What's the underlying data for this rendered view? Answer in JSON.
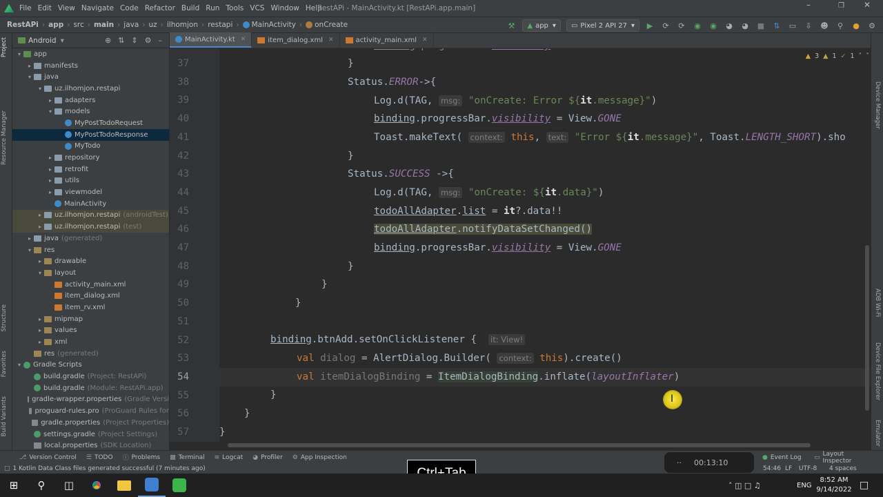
{
  "menubar": {
    "items": [
      "File",
      "Edit",
      "View",
      "Navigate",
      "Code",
      "Refactor",
      "Build",
      "Run",
      "Tools",
      "VCS",
      "Window",
      "Help"
    ],
    "title": "RestAPi - MainActivity.kt [RestAPi.app.main]"
  },
  "navbar": {
    "breadcrumbs": [
      "RestAPi",
      "app",
      "src",
      "main",
      "java",
      "uz",
      "ilhomjon",
      "restapi",
      "MainActivity",
      "onCreate"
    ],
    "run_config": "app",
    "device": "Pixel 2 API 27"
  },
  "left_strip": {
    "project": "Project",
    "resource_manager": "Resource Manager",
    "structure": "Structure",
    "favorites": "Favorites",
    "build_variants": "Build Variants"
  },
  "right_strip": {
    "device_manager": "Device Manager",
    "adb_wifi": "ADB Wi-Fi",
    "device_file_explorer": "Device File Explorer",
    "emulator": "Emulator"
  },
  "project": {
    "view": "Android",
    "tree": [
      {
        "label": "app",
        "icon": "app",
        "depth": 0,
        "arrow": "▾"
      },
      {
        "label": "manifests",
        "icon": "folder",
        "depth": 1,
        "arrow": "▸"
      },
      {
        "label": "java",
        "icon": "folder",
        "depth": 1,
        "arrow": "▾"
      },
      {
        "label": "uz.ilhomjon.restapi",
        "icon": "pkg",
        "depth": 2,
        "arrow": "▾"
      },
      {
        "label": "adapters",
        "icon": "pkg",
        "depth": 3,
        "arrow": "▸"
      },
      {
        "label": "models",
        "icon": "pkg",
        "depth": 3,
        "arrow": "▾"
      },
      {
        "label": "MyPostTodoRequest",
        "icon": "kt",
        "depth": 4,
        "arrow": ""
      },
      {
        "label": "MyPostTodoResponse",
        "icon": "kt",
        "depth": 4,
        "arrow": "",
        "sel": true
      },
      {
        "label": "MyTodo",
        "icon": "kt",
        "depth": 4,
        "arrow": ""
      },
      {
        "label": "repository",
        "icon": "pkg",
        "depth": 3,
        "arrow": "▸"
      },
      {
        "label": "retrofit",
        "icon": "pkg",
        "depth": 3,
        "arrow": "▸"
      },
      {
        "label": "utils",
        "icon": "pkg",
        "depth": 3,
        "arrow": "▸"
      },
      {
        "label": "viewmodel",
        "icon": "pkg",
        "depth": 3,
        "arrow": "▸"
      },
      {
        "label": "MainActivity",
        "icon": "kt",
        "depth": 3,
        "arrow": ""
      },
      {
        "label": "uz.ilhomjon.restapi",
        "icon": "pkg",
        "depth": 2,
        "arrow": "▸",
        "dim": "(androidTest)",
        "hl": true
      },
      {
        "label": "uz.ilhomjon.restapi",
        "icon": "pkg",
        "depth": 2,
        "arrow": "▸",
        "dim": "(test)",
        "hl": true
      },
      {
        "label": "java",
        "icon": "folder",
        "depth": 1,
        "arrow": "▸",
        "dim": "(generated)"
      },
      {
        "label": "res",
        "icon": "res",
        "depth": 1,
        "arrow": "▾"
      },
      {
        "label": "drawable",
        "icon": "res",
        "depth": 2,
        "arrow": "▸"
      },
      {
        "label": "layout",
        "icon": "res",
        "depth": 2,
        "arrow": "▾"
      },
      {
        "label": "activity_main.xml",
        "icon": "xml",
        "depth": 3,
        "arrow": ""
      },
      {
        "label": "item_dialog.xml",
        "icon": "xml",
        "depth": 3,
        "arrow": ""
      },
      {
        "label": "item_rv.xml",
        "icon": "xml",
        "depth": 3,
        "arrow": ""
      },
      {
        "label": "mipmap",
        "icon": "res",
        "depth": 2,
        "arrow": "▸"
      },
      {
        "label": "values",
        "icon": "res",
        "depth": 2,
        "arrow": "▸"
      },
      {
        "label": "xml",
        "icon": "res",
        "depth": 2,
        "arrow": "▸"
      },
      {
        "label": "res",
        "icon": "res",
        "depth": 1,
        "arrow": "",
        "dim": "(generated)"
      },
      {
        "label": "Gradle Scripts",
        "icon": "gradle",
        "depth": 0,
        "arrow": "▾"
      },
      {
        "label": "build.gradle",
        "icon": "gradle",
        "depth": 1,
        "arrow": "",
        "dim": "(Project: RestAPi)"
      },
      {
        "label": "build.gradle",
        "icon": "gradle",
        "depth": 1,
        "arrow": "",
        "dim": "(Module: RestAPi.app)"
      },
      {
        "label": "gradle-wrapper.properties",
        "icon": "prop",
        "depth": 1,
        "arrow": "",
        "dim": "(Gradle Versi"
      },
      {
        "label": "proguard-rules.pro",
        "icon": "prop",
        "depth": 1,
        "arrow": "",
        "dim": "(ProGuard Rules for"
      },
      {
        "label": "gradle.properties",
        "icon": "prop",
        "depth": 1,
        "arrow": "",
        "dim": "(Project Properties)"
      },
      {
        "label": "settings.gradle",
        "icon": "gradle",
        "depth": 1,
        "arrow": "",
        "dim": "(Project Settings)"
      },
      {
        "label": "local.properties",
        "icon": "prop",
        "depth": 1,
        "arrow": "",
        "dim": "(SDK Location)"
      }
    ]
  },
  "tabs": [
    {
      "label": "MainActivity.kt",
      "active": true,
      "icon": "kt"
    },
    {
      "label": "item_dialog.xml",
      "active": false,
      "icon": "xml"
    },
    {
      "label": "activity_main.xml",
      "active": false,
      "icon": "xml"
    }
  ],
  "inspections": {
    "warnings": "3",
    "weak": "1",
    "typos": "1"
  },
  "editor": {
    "line_numbers": [
      "37",
      "38",
      "39",
      "40",
      "41",
      "42",
      "43",
      "44",
      "45",
      "46",
      "47",
      "48",
      "49",
      "50",
      "51",
      "52",
      "53",
      "54",
      "55",
      "56",
      "57"
    ],
    "current_line": "54",
    "hints": {
      "msg": "msg:",
      "context": "context:",
      "text": "text:",
      "it_view": "it: View!"
    },
    "strings": {
      "l39_str_a": "\"onCreate: Error ${",
      "l39_str_b": "it",
      "l39_str_c": ".message}\"",
      "l41_str_a": "\"Error ${",
      "l41_str_b": "it",
      "l41_str_c": ".message}\"",
      "l44_str_a": "\"onCreate: ${",
      "l44_str_b": "it",
      "l44_str_c": ".data}\""
    }
  },
  "bottom_tools": [
    "Version Control",
    "TODO",
    "Problems",
    "Terminal",
    "Logcat",
    "Profiler",
    "App Inspection"
  ],
  "bottom_right": [
    "Event Log",
    "Layout Inspector"
  ],
  "status": {
    "message": "1 Kotlin Data Class files generated successful (7 minutes ago)",
    "position": "54:46",
    "line_sep": "LF",
    "encoding": "UTF-8",
    "indent": "4 spaces"
  },
  "overlay": {
    "key_hint": "Ctrl+Tab",
    "timer": "00:13:10"
  },
  "taskbar": {
    "lang": "ENG",
    "time": "8:52 AM",
    "date": "9/14/2022"
  }
}
